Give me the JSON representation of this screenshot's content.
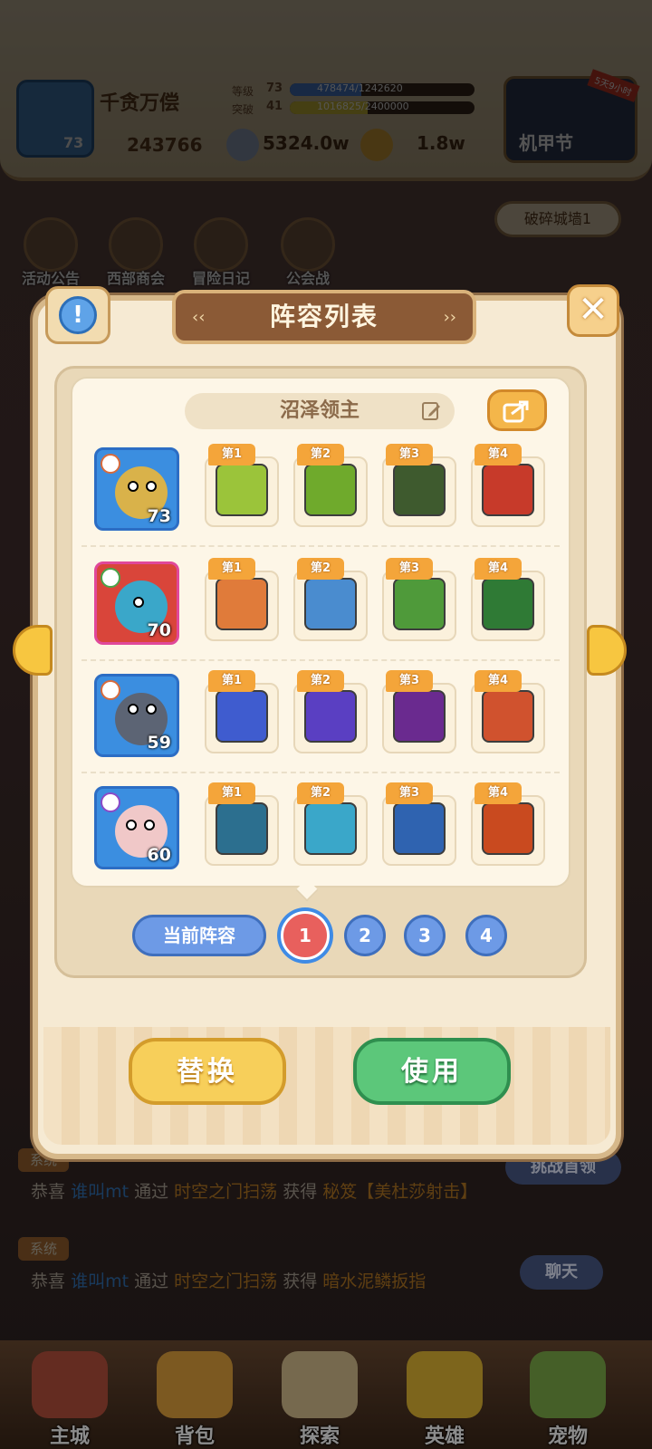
{
  "player": {
    "name": "千贪万偿",
    "level": "73",
    "power": "243766",
    "level_label": "等级",
    "level_value": "73",
    "exp_text": "478474/1242620",
    "exp_fraction": 0.385,
    "break_label": "突破",
    "break_value": "41",
    "break_text": "1016825/2400000",
    "break_fraction": 0.424
  },
  "currency": {
    "silver": "5324.0w",
    "gold": "1.8w"
  },
  "event": {
    "label": "机甲节",
    "tag": "5天9小时"
  },
  "top_menu": [
    "活动公告",
    "西部商会",
    "冒险日记",
    "公会战"
  ],
  "side": {
    "wall_label": "破碎城墙1"
  },
  "chat": {
    "sys_label": "系统",
    "lines": [
      {
        "pre": "恭喜",
        "user": "谁叫mt",
        "via": "通过",
        "place": "时空之门扫荡",
        "get": "获得",
        "item": "秘笈【美杜莎射击】"
      },
      {
        "pre": "恭喜",
        "user": "谁叫mt",
        "via": "通过",
        "place": "时空之门扫荡",
        "get": "获得",
        "item": "暗水泥鳞扳指"
      }
    ]
  },
  "right_pills": {
    "challenge": "挑战首领",
    "chat": "聊天"
  },
  "nav": [
    "主城",
    "背包",
    "探索",
    "英雄",
    "宠物"
  ],
  "modal": {
    "title": "阵容列表",
    "lineup_name": "沼泽领主",
    "current_label": "当前阵容",
    "pages": [
      "1",
      "2",
      "3",
      "4"
    ],
    "active_page": "1",
    "replace_label": "替换",
    "use_label": "使用",
    "close_symbol": "✕",
    "info_symbol": "!"
  },
  "heroes": [
    {
      "level": "73",
      "skills": [
        "第1",
        "第2",
        "第3",
        "第4"
      ]
    },
    {
      "level": "70",
      "skills": [
        "第1",
        "第2",
        "第3",
        "第4"
      ]
    },
    {
      "level": "59",
      "skills": [
        "第1",
        "第2",
        "第3",
        "第4"
      ]
    },
    {
      "level": "60",
      "skills": [
        "第1",
        "第2",
        "第3",
        "第4"
      ]
    }
  ],
  "colors": {
    "accent_blue": "#6d9ae6",
    "active_red": "#e8605d",
    "replace_yellow": "#f7cf5a",
    "use_green": "#5cc77a",
    "badge_orange": "#f4a53a"
  }
}
